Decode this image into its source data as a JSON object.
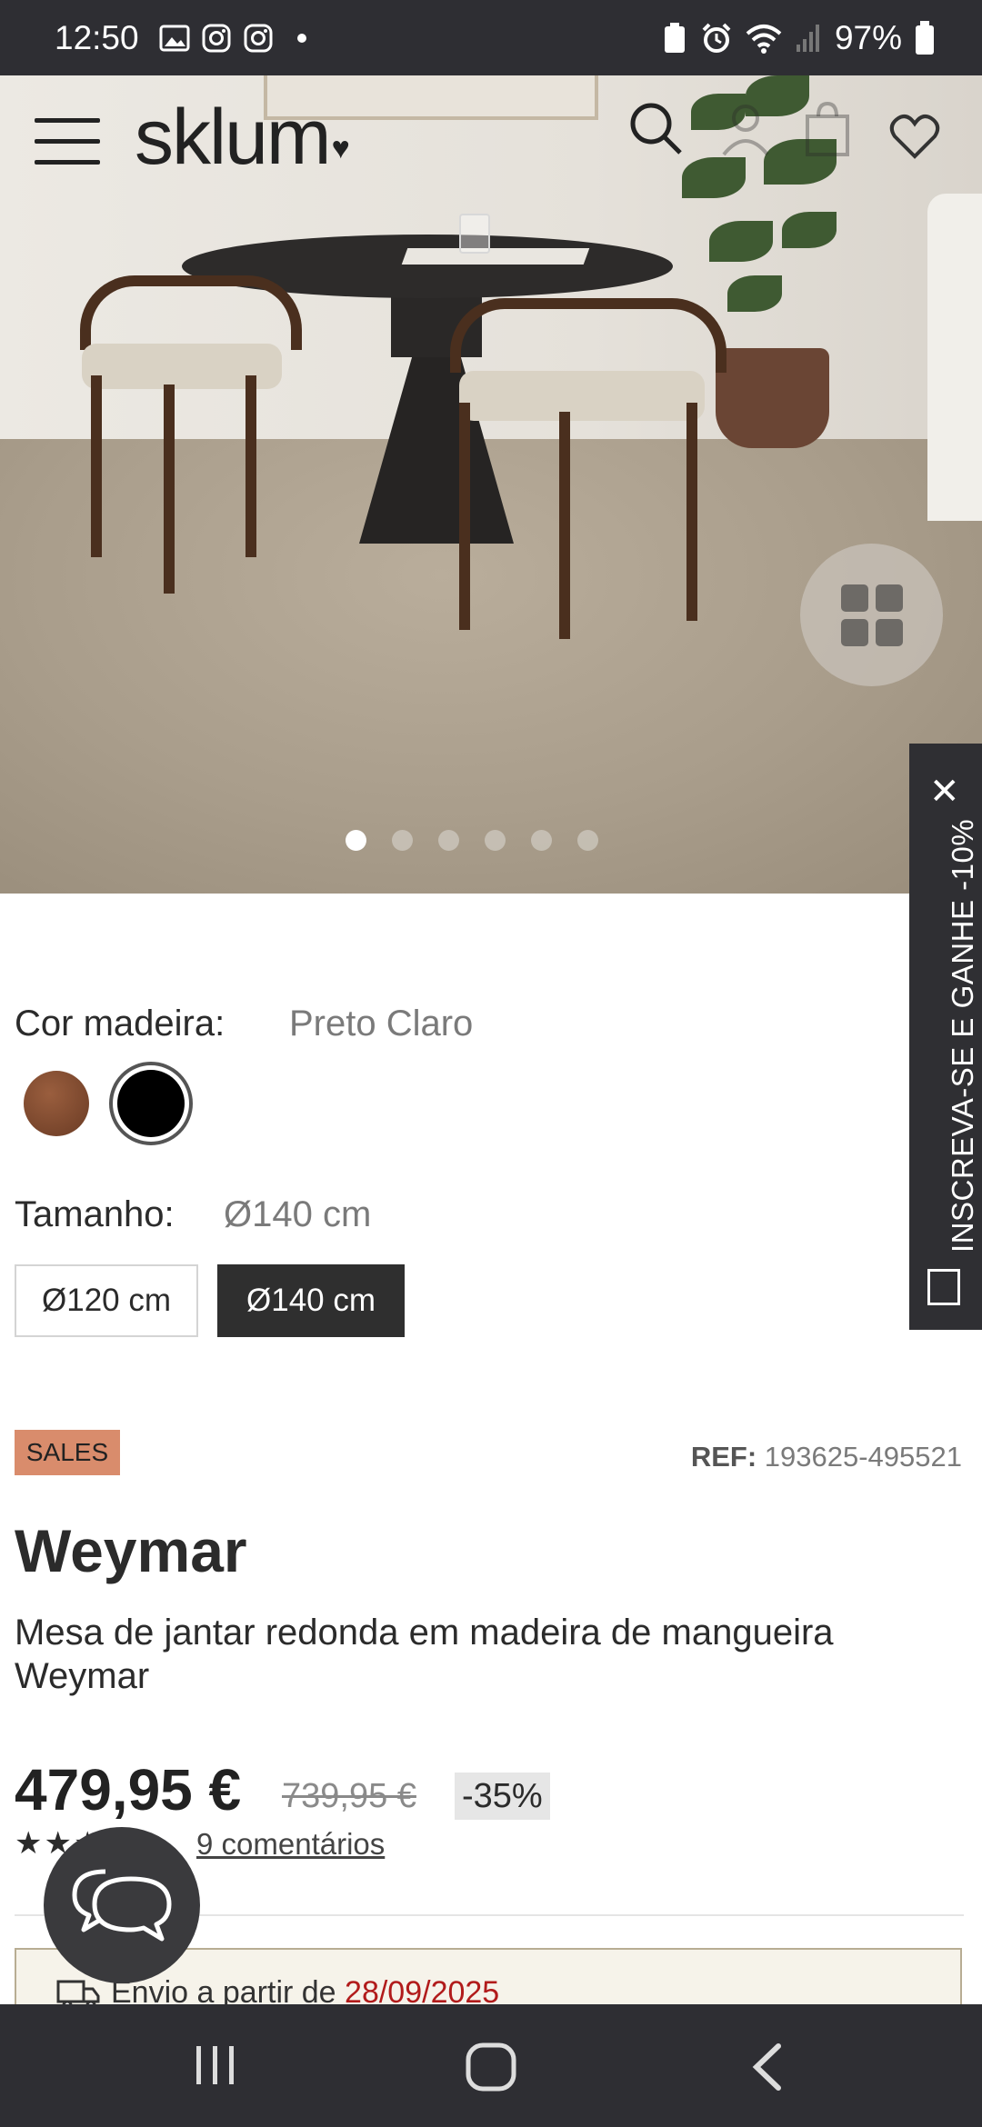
{
  "status_bar": {
    "time": "12:50",
    "battery": "97%"
  },
  "header": {
    "logo": "sklum"
  },
  "gallery": {
    "slide_count": 6,
    "active_index": 0
  },
  "newsletter_tab": {
    "text": "INSCREVA-SE E GANHE -10%"
  },
  "options": {
    "wood_color_label": "Cor madeira:",
    "wood_color_value": "Preto Claro",
    "swatches": [
      {
        "name": "walnut",
        "color": "#7a4a30",
        "selected": false
      },
      {
        "name": "black",
        "color": "#000000",
        "selected": true
      }
    ],
    "size_label": "Tamanho:",
    "size_value": "Ø140 cm",
    "sizes": [
      {
        "label": "Ø120 cm",
        "selected": false
      },
      {
        "label": "Ø140 cm",
        "selected": true
      }
    ]
  },
  "product": {
    "badge": "SALES",
    "ref_label": "REF:",
    "ref_value": "193625-495521",
    "title": "Weymar",
    "subtitle": "Mesa de jantar redonda em madeira de mangueira Weymar",
    "price": "479,95 €",
    "old_price": "739,95 €",
    "discount": "-35%",
    "rating": 5,
    "reviews": "9 comentários"
  },
  "shipping": {
    "text": "Envio a partir de",
    "date": "28/09/2025"
  },
  "colors": {
    "dark": "#2e2e33",
    "sales_badge": "#d98c6c",
    "date_red": "#b11b1b"
  }
}
